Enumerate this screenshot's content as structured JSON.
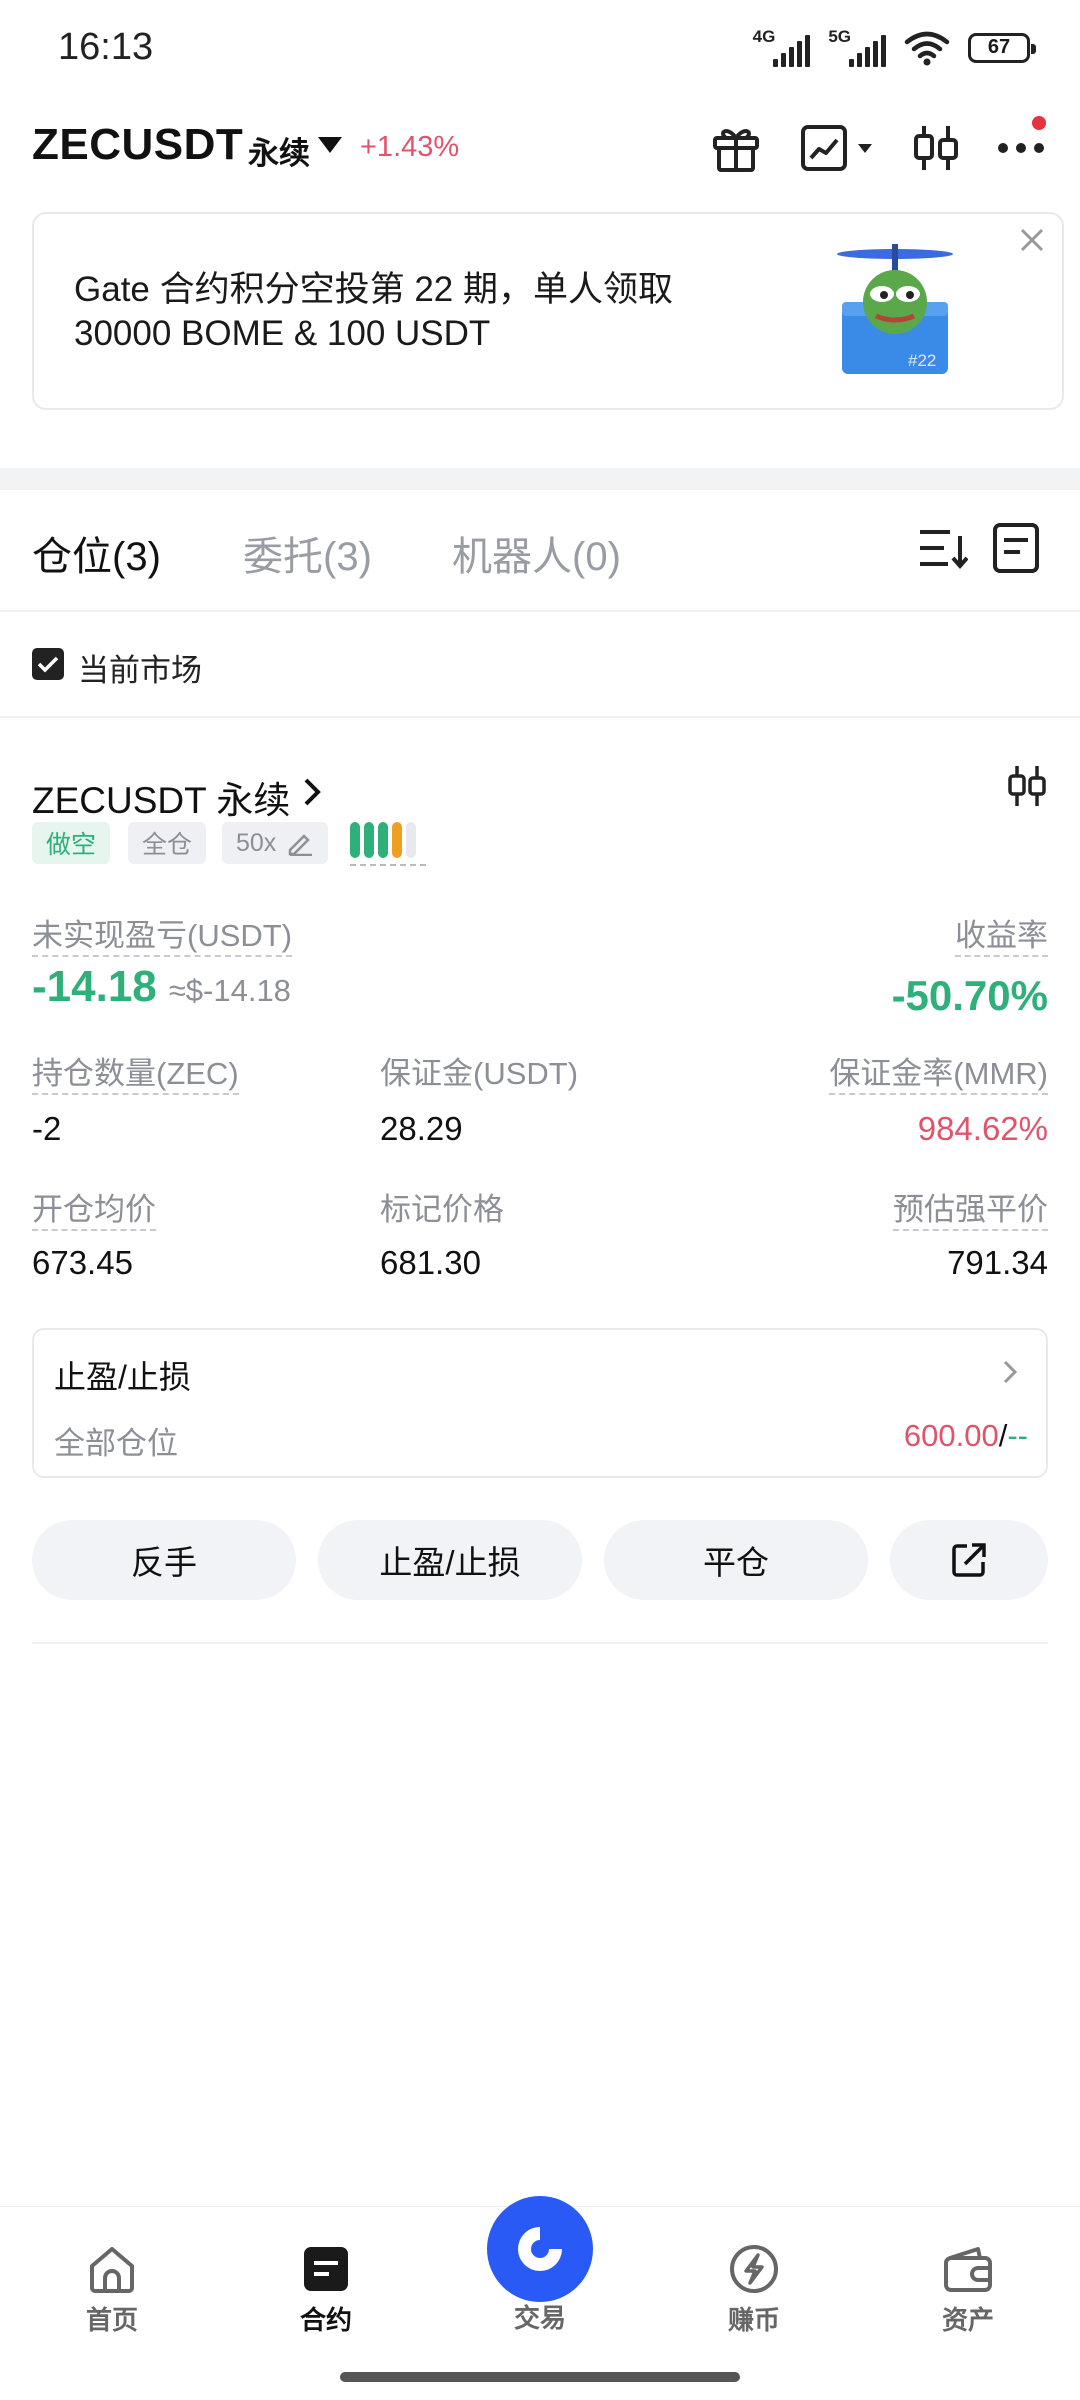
{
  "status_bar": {
    "time": "16:13",
    "net1": "4G",
    "net2": "5G",
    "battery": "67"
  },
  "header": {
    "pair": "ZECUSDT",
    "contract_type": "永续",
    "change": "+1.43%",
    "icons": [
      "gift-icon",
      "chart-icon",
      "candlestick-icon",
      "more-icon"
    ]
  },
  "banner": {
    "text_line1": "Gate 合约积分空投第 22 期，单人领取",
    "text_line2": "30000 BOME & 100 USDT",
    "badge": "#22"
  },
  "tabs": {
    "positions": "仓位(3)",
    "orders": "委托(3)",
    "bots": "机器人(0)"
  },
  "filter": {
    "current_market_label": "当前市场",
    "checked": true
  },
  "position": {
    "title": "ZECUSDT 永续",
    "side_tag": "做空",
    "mode_tag": "全仓",
    "leverage_tag": "50x",
    "unrealized_pnl_label": "未实现盈亏(USDT)",
    "unrealized_pnl": "-14.18",
    "unrealized_pnl_approx": "≈$-14.18",
    "roe_label": "收益率",
    "roe": "-50.70%",
    "size_label": "持仓数量(ZEC)",
    "size": "-2",
    "margin_label": "保证金(USDT)",
    "margin": "28.29",
    "mmr_label": "保证金率(MMR)",
    "mmr": "984.62%",
    "entry_label": "开仓均价",
    "entry": "673.45",
    "mark_label": "标记价格",
    "mark": "681.30",
    "liq_label": "预估强平价",
    "liq": "791.34",
    "colors": {
      "up": "#2fb07a",
      "down": "#e0546b"
    }
  },
  "tpsl": {
    "title": "止盈/止损",
    "scope": "全部仓位",
    "tp_value": "600.00",
    "sep": "/",
    "sl_value": "--"
  },
  "actions": {
    "reverse": "反手",
    "tpsl": "止盈/止损",
    "close": "平仓"
  },
  "bottom_nav": {
    "home": "首页",
    "futures": "合约",
    "trade": "交易",
    "earn": "赚币",
    "assets": "资产"
  },
  "colors": {
    "accent": "#2a5af5",
    "green": "#2fb07a",
    "red": "#e0546b"
  }
}
